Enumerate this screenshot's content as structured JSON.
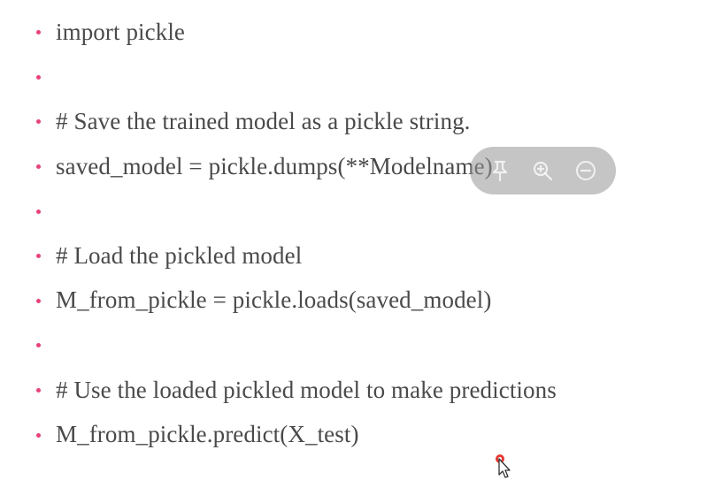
{
  "code_lines": [
    "import pickle",
    "",
    "# Save the trained model as a pickle string.",
    "saved_model = pickle.dumps(**Modelname)",
    "",
    "# Load the pickled model",
    "M_from_pickle = pickle.loads(saved_model)",
    "",
    "# Use the loaded pickled model to make predictions",
    "M_from_pickle.predict(X_test)"
  ],
  "toolbar": {
    "icons": [
      "pin-icon",
      "zoom-in-icon",
      "zoom-out-icon"
    ]
  },
  "colors": {
    "bullet": "#e8417a",
    "text": "#4a4a4a",
    "toolbar_bg": "#969696"
  }
}
